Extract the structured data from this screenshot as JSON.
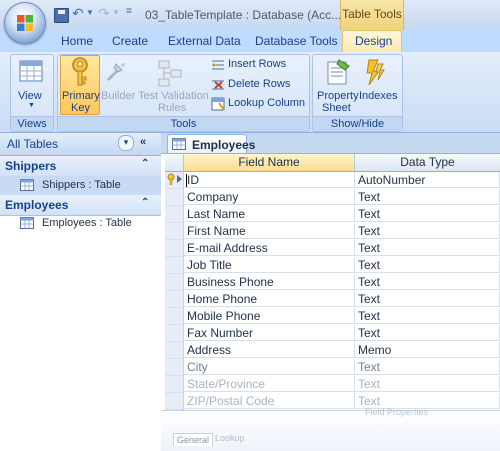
{
  "window": {
    "title": "03_TableTemplate : Database (Acc..."
  },
  "context_tab": {
    "label": "Table Tools"
  },
  "tabs": [
    "Home",
    "Create",
    "External Data",
    "Database Tools",
    "Design"
  ],
  "ribbon": {
    "views": {
      "caption": "Views",
      "view_label": "View"
    },
    "tools": {
      "caption": "Tools",
      "primary_key": [
        "Primary",
        "Key"
      ],
      "builder": "Builder",
      "test_validation": [
        "Test Validation",
        "Rules"
      ],
      "insert_rows": "Insert Rows",
      "delete_rows": "Delete Rows",
      "lookup_column": "Lookup Column"
    },
    "show_hide": {
      "caption": "Show/Hide",
      "property_sheet": [
        "Property",
        "Sheet"
      ],
      "indexes": "Indexes"
    }
  },
  "nav": {
    "header": "All Tables",
    "groups": [
      {
        "name": "Shippers",
        "items": [
          "Shippers : Table"
        ]
      },
      {
        "name": "Employees",
        "items": [
          "Employees : Table"
        ]
      }
    ]
  },
  "document": {
    "tab_label": "Employees",
    "columns": [
      "Field Name",
      "Data Type"
    ],
    "rows": [
      {
        "field": "ID",
        "type": "AutoNumber"
      },
      {
        "field": "Company",
        "type": "Text"
      },
      {
        "field": "Last Name",
        "type": "Text"
      },
      {
        "field": "First Name",
        "type": "Text"
      },
      {
        "field": "E-mail Address",
        "type": "Text"
      },
      {
        "field": "Job Title",
        "type": "Text"
      },
      {
        "field": "Business Phone",
        "type": "Text"
      },
      {
        "field": "Home Phone",
        "type": "Text"
      },
      {
        "field": "Mobile Phone",
        "type": "Text"
      },
      {
        "field": "Fax Number",
        "type": "Text"
      },
      {
        "field": "Address",
        "type": "Memo"
      },
      {
        "field": "City",
        "type": "Text"
      },
      {
        "field": "State/Province",
        "type": "Text"
      },
      {
        "field": "ZIP/Postal Code",
        "type": "Text"
      }
    ],
    "field_properties": "Field Properties",
    "bottom_tabs": [
      "General",
      "Lookup"
    ]
  }
}
